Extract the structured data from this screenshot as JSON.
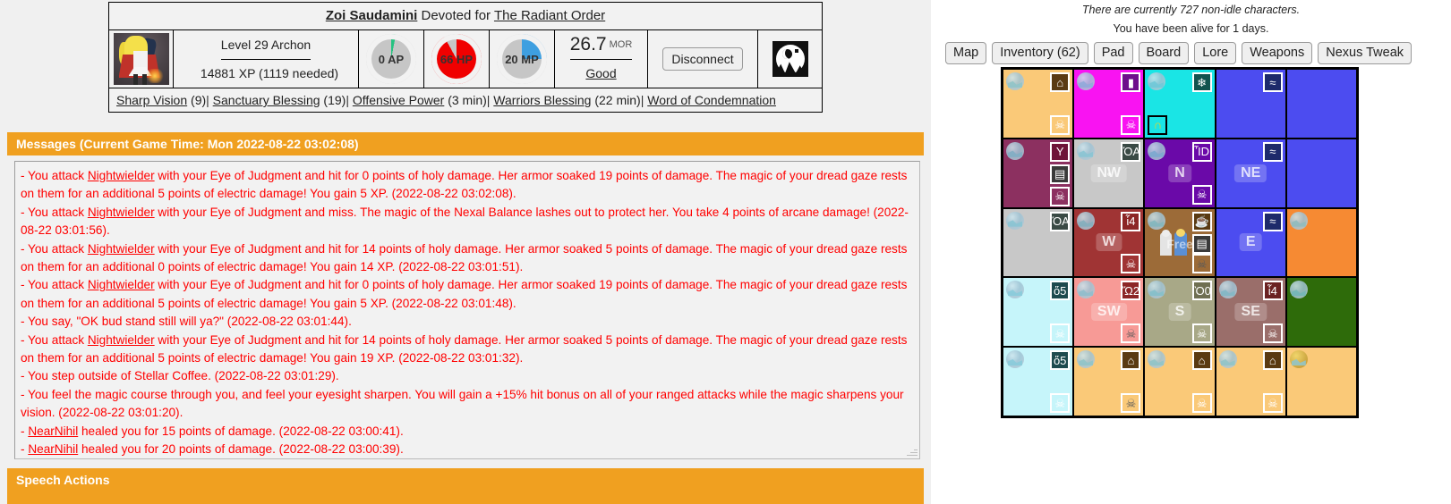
{
  "character": {
    "name": "Zoi Saudamini",
    "affiliation_prefix": "Devoted for",
    "guild": "The Radiant Order",
    "level_text": "Level 29 Archon",
    "xp_text": "14881 XP (1119 needed)",
    "ap_label": "0 AP",
    "hp_label": "66 HP",
    "mp_label": "20 MP",
    "mor_value": "26.7",
    "mor_unit": "MOR",
    "mor_status": "Good",
    "disconnect_label": "Disconnect",
    "avatar_name": "character-portrait",
    "logo_name": "night-moon-logo",
    "ap_pct": 3,
    "hp_pct": 92,
    "mp_pct": 25,
    "ap_color": "#26c281",
    "hp_color": "#f00000",
    "mp_color": "#3e9fe0",
    "ring_track": "#c6c6c6"
  },
  "buffs": [
    {
      "name": "Sharp Vision",
      "value": "(9)"
    },
    {
      "name": "Sanctuary Blessing",
      "value": "(19)"
    },
    {
      "name": "Offensive Power",
      "value": "(3 min)"
    },
    {
      "name": "Warriors Blessing",
      "value": "(22 min)"
    },
    {
      "name": "Word of Condemnation",
      "value": ""
    }
  ],
  "messages_panel": {
    "header": "Messages (Current Game Time: Mon 2022-08-22 03:02:08)",
    "speech_header": "Speech Actions",
    "text_color": "#ff0000",
    "lines": [
      {
        "pre": "- You attack ",
        "link": "Nightwielder",
        "post": " with your Eye of Judgment and hit for 0 points of holy damage. Her armor soaked 19 points of damage. The magic of your dread gaze rests on them for an additional 5 points of electric damage! You gain 5 XP. (2022-08-22 03:02:08)."
      },
      {
        "pre": "- You attack ",
        "link": "Nightwielder",
        "post": " with your Eye of Judgment and miss. The magic of the Nexal Balance lashes out to protect her. You take 4 points of arcane damage! (2022-08-22 03:01:56)."
      },
      {
        "pre": "- You attack ",
        "link": "Nightwielder",
        "post": " with your Eye of Judgment and hit for 14 points of holy damage. Her armor soaked 5 points of damage. The magic of your dread gaze rests on them for an additional 0 points of electric damage! You gain 14 XP. (2022-08-22 03:01:51)."
      },
      {
        "pre": "- You attack ",
        "link": "Nightwielder",
        "post": " with your Eye of Judgment and hit for 0 points of holy damage. Her armor soaked 19 points of damage. The magic of your dread gaze rests on them for an additional 5 points of electric damage! You gain 5 XP. (2022-08-22 03:01:48)."
      },
      {
        "pre": "- You say, \"OK bud stand still will ya?\" (2022-08-22 03:01:44).",
        "link": "",
        "post": ""
      },
      {
        "pre": "- You attack ",
        "link": "Nightwielder",
        "post": " with your Eye of Judgment and hit for 14 points of holy damage. Her armor soaked 5 points of damage. The magic of your dread gaze rests on them for an additional 5 points of electric damage! You gain 19 XP. (2022-08-22 03:01:32)."
      },
      {
        "pre": "- You step outside of Stellar Coffee. (2022-08-22 03:01:29).",
        "link": "",
        "post": ""
      },
      {
        "pre": "- You feel the magic course through you, and feel your eyesight sharpen. You will gain a +15% hit bonus on all of your ranged attacks while the magic sharpens your vision. (2022-08-22 03:01:20).",
        "link": "",
        "post": ""
      },
      {
        "pre": "- ",
        "link": "NearNihil",
        "post": " healed you for 15 points of damage. (2022-08-22 03:00:41)."
      },
      {
        "pre": "- ",
        "link": "NearNihil",
        "post": " healed you for 20 points of damage. (2022-08-22 03:00:39)."
      }
    ]
  },
  "right_panel": {
    "status_line": "There are currently 727 non-idle characters.",
    "alive_line": "You have been alive for 1 days.",
    "buttons": [
      {
        "label": "Map",
        "name": "map-button"
      },
      {
        "label": "Inventory (62)",
        "name": "inventory-button"
      },
      {
        "label": "Pad",
        "name": "pad-button"
      },
      {
        "label": "Board",
        "name": "board-button"
      },
      {
        "label": "Lore",
        "name": "lore-button"
      },
      {
        "label": "Weapons",
        "name": "weapons-button"
      },
      {
        "label": "Nexus Tweak",
        "name": "nexus-tweak-button"
      }
    ]
  },
  "map": {
    "rows": 5,
    "cols": 5,
    "cells": [
      {
        "bg": "#fac978",
        "dir": "",
        "compass": true,
        "icons": [
          {
            "glyph": "⌂",
            "bg": "#5a3a12",
            "fg": "#ffffff",
            "pos": "t0",
            "name": "building-icon"
          },
          {
            "glyph": "☠",
            "bg": "#fac978",
            "fg": "#ffffff",
            "pos": "bot",
            "name": "lamp-icon"
          }
        ]
      },
      {
        "bg": "#f913f2",
        "dir": "",
        "compass": true,
        "icons": [
          {
            "glyph": "▮",
            "bg": "#6e0d8c",
            "fg": "#ffffff",
            "pos": "t0",
            "name": "tower-icon"
          },
          {
            "glyph": "☠",
            "bg": "#f913f2",
            "fg": "#ffffff",
            "pos": "bot",
            "name": "lamp-icon"
          }
        ]
      },
      {
        "bg": "#1ae5e5",
        "dir": "",
        "compass": true,
        "icons": [
          {
            "glyph": "❄",
            "bg": "#12544f",
            "fg": "#ffffff",
            "pos": "t0",
            "name": "fountain-icon"
          },
          {
            "glyph": "∩",
            "bg": "#1ae5e5",
            "fg": "#f2d21a",
            "pos": "b-left",
            "name": "monument-icon"
          }
        ]
      },
      {
        "bg": "#4c4cf0",
        "dir": "",
        "compass": false,
        "icons": [
          {
            "glyph": "≈",
            "bg": "#1e2a6b",
            "fg": "#ffffff",
            "pos": "t0",
            "name": "water-icon"
          }
        ]
      },
      {
        "bg": "#4c4cf0",
        "dir": "",
        "compass": false,
        "icons": []
      },
      {
        "bg": "#8c3060",
        "dir": "",
        "compass": true,
        "icons": [
          {
            "glyph": "Y",
            "bg": "#6e1438",
            "fg": "#ffffff",
            "pos": "t0",
            "name": "bar-icon"
          },
          {
            "glyph": "▤",
            "bg": "#3a3a3a",
            "fg": "#ffffff",
            "pos": "t1",
            "name": "bank-icon"
          },
          {
            "glyph": "☠",
            "bg": "#8c3060",
            "fg": "#ffffff",
            "pos": "t2",
            "name": "lamp-icon"
          }
        ]
      },
      {
        "bg": "#c8c8c8",
        "dir": "NW",
        "compass": true,
        "icons": [
          {
            "glyph": "ὌA",
            "bg": "#3a4a45",
            "fg": "#ffffff",
            "pos": "t0",
            "name": "chart-icon"
          }
        ]
      },
      {
        "bg": "#6a09a8",
        "dir": "N",
        "compass": true,
        "icons": [
          {
            "glyph": "ἾD",
            "bg": "#6a09a8",
            "fg": "#ffffff",
            "pos": "t0",
            "name": "factory-icon"
          },
          {
            "glyph": "☠",
            "bg": "#6a09a8",
            "fg": "#ffffff",
            "pos": "bot",
            "name": "lamp-icon"
          }
        ]
      },
      {
        "bg": "#4c4cf0",
        "dir": "NE",
        "compass": false,
        "icons": [
          {
            "glyph": "≈",
            "bg": "#1e2a6b",
            "fg": "#ffffff",
            "pos": "t0",
            "name": "water-icon"
          }
        ]
      },
      {
        "bg": "#4c4cf0",
        "dir": "",
        "compass": false,
        "icons": []
      },
      {
        "bg": "#c8c8c8",
        "dir": "",
        "compass": true,
        "icons": [
          {
            "glyph": "ὌA",
            "bg": "#3a4a45",
            "fg": "#ffffff",
            "pos": "t0",
            "name": "chart-icon"
          }
        ]
      },
      {
        "bg": "#a03434",
        "dir": "W",
        "compass": true,
        "icons": [
          {
            "glyph": "ἷ4",
            "bg": "#8c2626",
            "fg": "#ffffff",
            "pos": "t0",
            "name": "restaurant-icon"
          },
          {
            "glyph": "☠",
            "bg": "#a03434",
            "fg": "#ffffff",
            "pos": "bot",
            "name": "lamp-icon"
          }
        ]
      },
      {
        "bg": "#9c6b38",
        "dir": "",
        "compass": true,
        "label": "Free",
        "sprites": true,
        "icons": [
          {
            "glyph": "☕",
            "bg": "#5a3a12",
            "fg": "#ffffff",
            "pos": "t0",
            "name": "cafe-icon"
          },
          {
            "glyph": "▤",
            "bg": "#3a3a3a",
            "fg": "#ffffff",
            "pos": "t1",
            "name": "bank-icon"
          },
          {
            "glyph": "☠",
            "bg": "#9c6b38",
            "fg": "#5a5a5a",
            "pos": "bot",
            "name": "lamp-dark-icon"
          }
        ]
      },
      {
        "bg": "#4c4cf0",
        "dir": "E",
        "compass": false,
        "icons": [
          {
            "glyph": "≈",
            "bg": "#1e2a6b",
            "fg": "#ffffff",
            "pos": "t0",
            "name": "water-icon"
          }
        ]
      },
      {
        "bg": "#f68a33",
        "dir": "",
        "compass": true,
        "icons": []
      },
      {
        "bg": "#c6f5fa",
        "dir": "",
        "compass": true,
        "icons": [
          {
            "glyph": "ὅ5",
            "bg": "#1e4a4e",
            "fg": "#ffffff",
            "pos": "t0",
            "name": "clothes-icon"
          },
          {
            "glyph": "☠",
            "bg": "#c6f5fa",
            "fg": "#ffffff",
            "pos": "bot",
            "name": "lamp-icon"
          }
        ]
      },
      {
        "bg": "#f79a96",
        "dir": "SW",
        "compass": true,
        "icons": [
          {
            "glyph": "Ὥ2",
            "bg": "#8c2626",
            "fg": "#ffffff",
            "pos": "t0",
            "name": "store-icon"
          },
          {
            "glyph": "☠",
            "bg": "#f79a96",
            "fg": "#5a5a5a",
            "pos": "bot",
            "name": "lamp-dark-icon"
          }
        ]
      },
      {
        "bg": "#a8a887",
        "dir": "S",
        "compass": true,
        "icons": [
          {
            "glyph": "Ὃ0",
            "bg": "#6f6f52",
            "fg": "#ffffff",
            "pos": "t0",
            "name": "bank-money-icon"
          },
          {
            "glyph": "☠",
            "bg": "#a8a887",
            "fg": "#ffffff",
            "pos": "bot",
            "name": "lamp-icon"
          }
        ]
      },
      {
        "bg": "#9a6e6a",
        "dir": "SE",
        "compass": true,
        "icons": [
          {
            "glyph": "ἷ4",
            "bg": "#6b2222",
            "fg": "#ffffff",
            "pos": "t0",
            "name": "restaurant-icon"
          },
          {
            "glyph": "☠",
            "bg": "#9a6e6a",
            "fg": "#ffffff",
            "pos": "bot",
            "name": "lamp-icon"
          }
        ]
      },
      {
        "bg": "#2e6b0a",
        "dir": "",
        "compass": true,
        "icons": []
      },
      {
        "bg": "#c6f5fa",
        "dir": "",
        "compass": true,
        "icons": [
          {
            "glyph": "ὅ5",
            "bg": "#1e4a4e",
            "fg": "#ffffff",
            "pos": "t0",
            "name": "clothes-icon"
          },
          {
            "glyph": "☠",
            "bg": "#c6f5fa",
            "fg": "#ffffff",
            "pos": "bot",
            "name": "lamp-icon"
          }
        ]
      },
      {
        "bg": "#fac978",
        "dir": "",
        "compass": true,
        "icons": [
          {
            "glyph": "⌂",
            "bg": "#5a3a12",
            "fg": "#ffffff",
            "pos": "t0",
            "name": "building-icon"
          },
          {
            "glyph": "☠",
            "bg": "#fac978",
            "fg": "#5a5a5a",
            "pos": "bot",
            "name": "lamp-dark-icon"
          }
        ]
      },
      {
        "bg": "#fac978",
        "dir": "",
        "compass": true,
        "icons": [
          {
            "glyph": "⌂",
            "bg": "#5a3a12",
            "fg": "#ffffff",
            "pos": "t0",
            "name": "building-icon"
          },
          {
            "glyph": "☠",
            "bg": "#fac978",
            "fg": "#ffffff",
            "pos": "bot",
            "name": "lamp-icon"
          }
        ]
      },
      {
        "bg": "#fac978",
        "dir": "",
        "compass": true,
        "icons": [
          {
            "glyph": "⌂",
            "bg": "#5a3a12",
            "fg": "#ffffff",
            "pos": "t0",
            "name": "building-icon"
          },
          {
            "glyph": "☠",
            "bg": "#fac978",
            "fg": "#ffffff",
            "pos": "bot",
            "name": "lamp-icon"
          }
        ]
      },
      {
        "bg": "#fac978",
        "dir": "",
        "compass": true,
        "compass_gold": true,
        "icons": []
      }
    ]
  }
}
